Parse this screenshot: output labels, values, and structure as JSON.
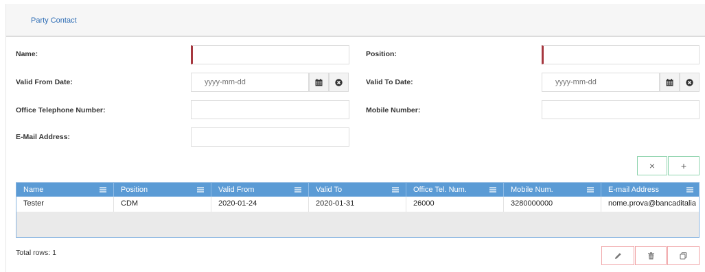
{
  "panel": {
    "title": "Party Contact"
  },
  "form": {
    "name": {
      "label": "Name:",
      "value": "",
      "placeholder": ""
    },
    "position": {
      "label": "Position:",
      "value": "",
      "placeholder": ""
    },
    "valid_from": {
      "label": "Valid From Date:",
      "value": "",
      "placeholder": "yyyy-mm-dd"
    },
    "valid_to": {
      "label": "Valid To Date:",
      "value": "",
      "placeholder": "yyyy-mm-dd"
    },
    "office_phone": {
      "label": "Office Telephone Number:",
      "value": "",
      "placeholder": ""
    },
    "mobile": {
      "label": "Mobile Number:",
      "value": "",
      "placeholder": ""
    },
    "email": {
      "label": "E-Mail Address:",
      "value": "",
      "placeholder": ""
    }
  },
  "form_buttons": {
    "clear": "×",
    "add": "+"
  },
  "table": {
    "columns": [
      "Name",
      "Position",
      "Valid From",
      "Valid To",
      "Office Tel. Num.",
      "Mobile Num.",
      "E-mail Address"
    ],
    "rows": [
      [
        "Tester",
        "CDM",
        "2020-01-24",
        "2020-01-31",
        "26000",
        "3280000000",
        "nome.prova@bancaditalia"
      ]
    ]
  },
  "footer": {
    "total_rows": "Total rows: 1"
  },
  "icons": {
    "calendar": "calendar-icon",
    "clear_date": "times-circle-icon",
    "column_menu": "hamburger-menu-icon",
    "edit": "pencil-icon",
    "delete": "trash-icon",
    "copy": "copy-icon"
  },
  "colors": {
    "accent": "#2e6db5",
    "grid_header": "#5b9bd5",
    "required_marker": "#a6373f",
    "green_border": "#8fd4ae",
    "red_border": "#f0a3a6"
  }
}
